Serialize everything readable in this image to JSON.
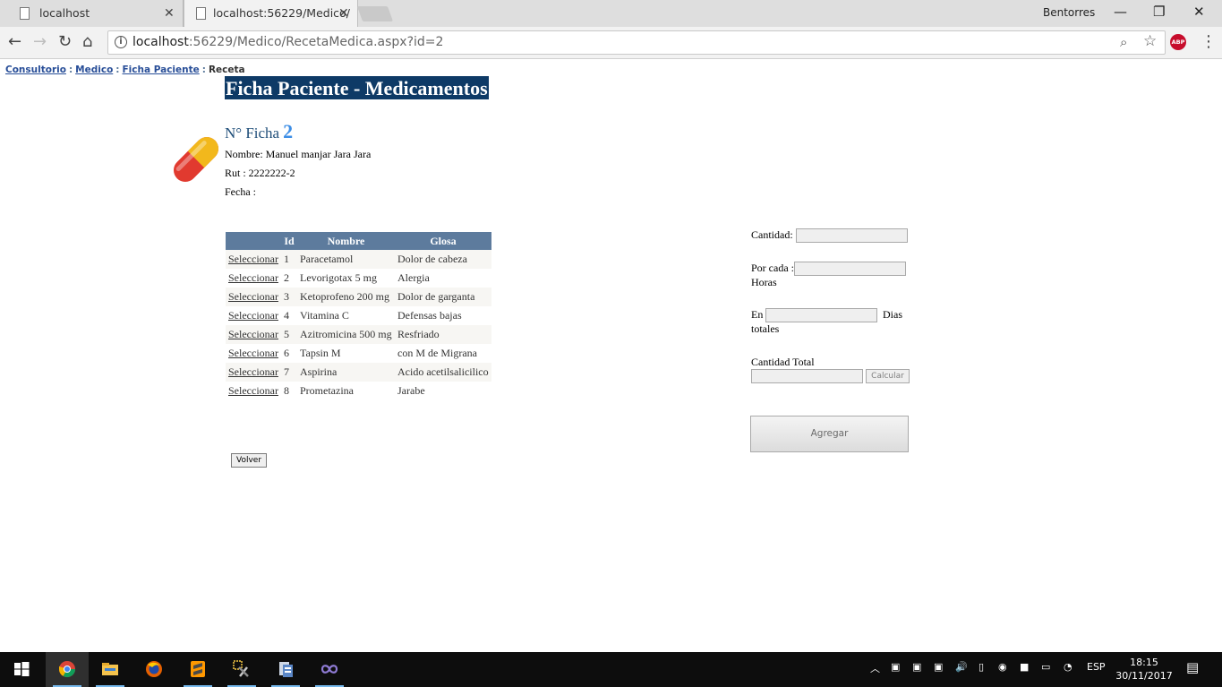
{
  "browser": {
    "tabs": [
      {
        "title": "localhost"
      },
      {
        "title": "localhost:56229/Medico/"
      }
    ],
    "window_user": "Bentorres",
    "url_host": "localhost",
    "url_path": ":56229/Medico/RecetaMedica.aspx?id=2",
    "abp_label": "ABP"
  },
  "breadcrumb": {
    "items": [
      "Consultorio",
      "Medico",
      "Ficha Paciente"
    ],
    "separator": ":",
    "current": "Receta"
  },
  "page": {
    "title": "Ficha Paciente - Medicamentos",
    "ficha_label": "N° Ficha",
    "ficha_number": "2",
    "nombre": "Nombre:  Manuel manjar Jara Jara",
    "rut": "Rut : 2222222-2",
    "fecha": "Fecha :"
  },
  "table": {
    "headers": [
      "",
      "Id",
      "Nombre",
      "Glosa"
    ],
    "select_label": "Seleccionar",
    "rows": [
      {
        "id": "1",
        "nombre": "Paracetamol",
        "glosa": "Dolor de cabeza"
      },
      {
        "id": "2",
        "nombre": "Levorigotax 5 mg",
        "glosa": "Alergia"
      },
      {
        "id": "3",
        "nombre": "Ketoprofeno 200 mg",
        "glosa": "Dolor de garganta"
      },
      {
        "id": "4",
        "nombre": "Vitamina C",
        "glosa": "Defensas bajas"
      },
      {
        "id": "5",
        "nombre": "Azitromicina 500 mg",
        "glosa": "Resfriado"
      },
      {
        "id": "6",
        "nombre": "Tapsin M",
        "glosa": "con M de Migrana"
      },
      {
        "id": "7",
        "nombre": "Aspirina",
        "glosa": "Acido acetilsalicilico"
      },
      {
        "id": "8",
        "nombre": "Prometazina",
        "glosa": "Jarabe"
      }
    ],
    "header_color": "#5d7b9d",
    "alt_row_color": "#f7f6f3"
  },
  "buttons": {
    "volver": "Volver",
    "calcular": "Calcular",
    "agregar": "Agregar"
  },
  "form": {
    "cantidad_label": "Cantidad:",
    "porcada_label": "Por cada :",
    "horas_label": "Horas",
    "en_label": "En",
    "dias_label": "Dias",
    "totales_label": "totales",
    "cantidad_total_label": "Cantidad Total",
    "cantidad_value": "",
    "porcada_value": "",
    "en_value": "",
    "total_value": ""
  },
  "colors": {
    "title_bg": "#0e3a66",
    "ficha_label": "#1f4e79",
    "ficha_number": "#3d8ee6",
    "link": "#284e98"
  },
  "taskbar": {
    "apps": [
      "start-icon",
      "chrome-icon",
      "file-explorer-icon",
      "firefox-icon",
      "sublime-text-icon",
      "tools-icon",
      "sql-server-icon",
      "visual-studio-icon"
    ],
    "language": "ESP",
    "time": "18:15",
    "date": "30/11/2017"
  }
}
